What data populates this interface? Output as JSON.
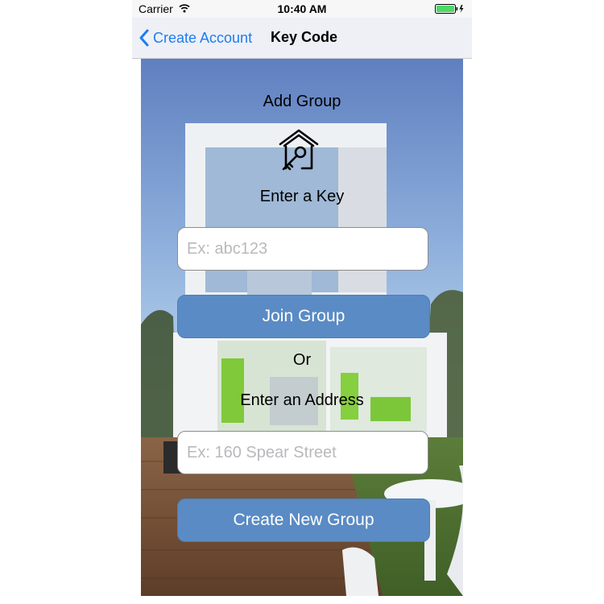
{
  "status_bar": {
    "carrier": "Carrier",
    "time": "10:40 AM"
  },
  "nav": {
    "back_label": "Create Account",
    "title": "Key Code"
  },
  "main": {
    "heading": "Add Group",
    "logo_icon": "house-key-icon",
    "key_label": "Enter a Key",
    "key_input": {
      "value": "",
      "placeholder": "Ex: abc123"
    },
    "join_button": "Join Group",
    "or_label": "Or",
    "address_label": "Enter an Address",
    "address_input": {
      "value": "",
      "placeholder": "Ex: 160 Spear Street"
    },
    "create_button": "Create New Group"
  },
  "colors": {
    "accent": "#1e7cf2",
    "button_fill": "#5a8bc4",
    "battery": "#4cd964"
  }
}
